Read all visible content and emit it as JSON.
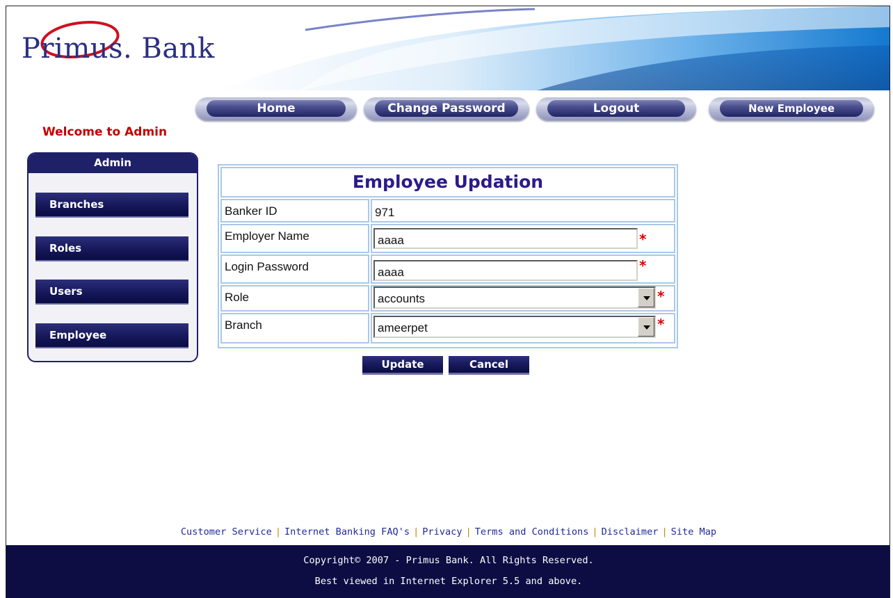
{
  "brand": {
    "logo_text": "Primus. Bank"
  },
  "nav": {
    "items": [
      {
        "label": "Home"
      },
      {
        "label": "Change Password"
      },
      {
        "label": "Logout"
      },
      {
        "label": "New Employee"
      }
    ]
  },
  "welcome_text": "Welcome to Admin",
  "sidebar": {
    "title": "Admin",
    "items": [
      {
        "label": "Branches"
      },
      {
        "label": "Roles"
      },
      {
        "label": "Users"
      },
      {
        "label": "Employee"
      }
    ]
  },
  "form": {
    "title": "Employee Updation",
    "banker_id_label": "Banker ID",
    "banker_id_value": "971",
    "employer_name_label": "Employer Name",
    "employer_name_value": "aaaa",
    "login_password_label": "Login Password",
    "login_password_value": "aaaa",
    "role_label": "Role",
    "role_value": "accounts",
    "branch_label": "Branch",
    "branch_value": "ameerpet",
    "required_mark": "*",
    "update_label": "Update",
    "cancel_label": "Cancel"
  },
  "footer": {
    "links": [
      {
        "label": "Customer Service"
      },
      {
        "label": "Internet Banking FAQ's"
      },
      {
        "label": "Privacy"
      },
      {
        "label": "Terms and Conditions"
      },
      {
        "label": "Disclaimer"
      },
      {
        "label": "Site Map"
      }
    ],
    "separator": "|",
    "copyright": "Copyright© 2007 - Primus Bank. All Rights Reserved.",
    "browser_note": "Best viewed in Internet Explorer 5.5 and above."
  },
  "colors": {
    "navy": "#1e2168",
    "welcome_red": "#c40000",
    "title_purple": "#2b1a8c",
    "required_red": "#e00000",
    "link_blue": "#1f2a9c",
    "footer_bg": "#0d0d44"
  }
}
